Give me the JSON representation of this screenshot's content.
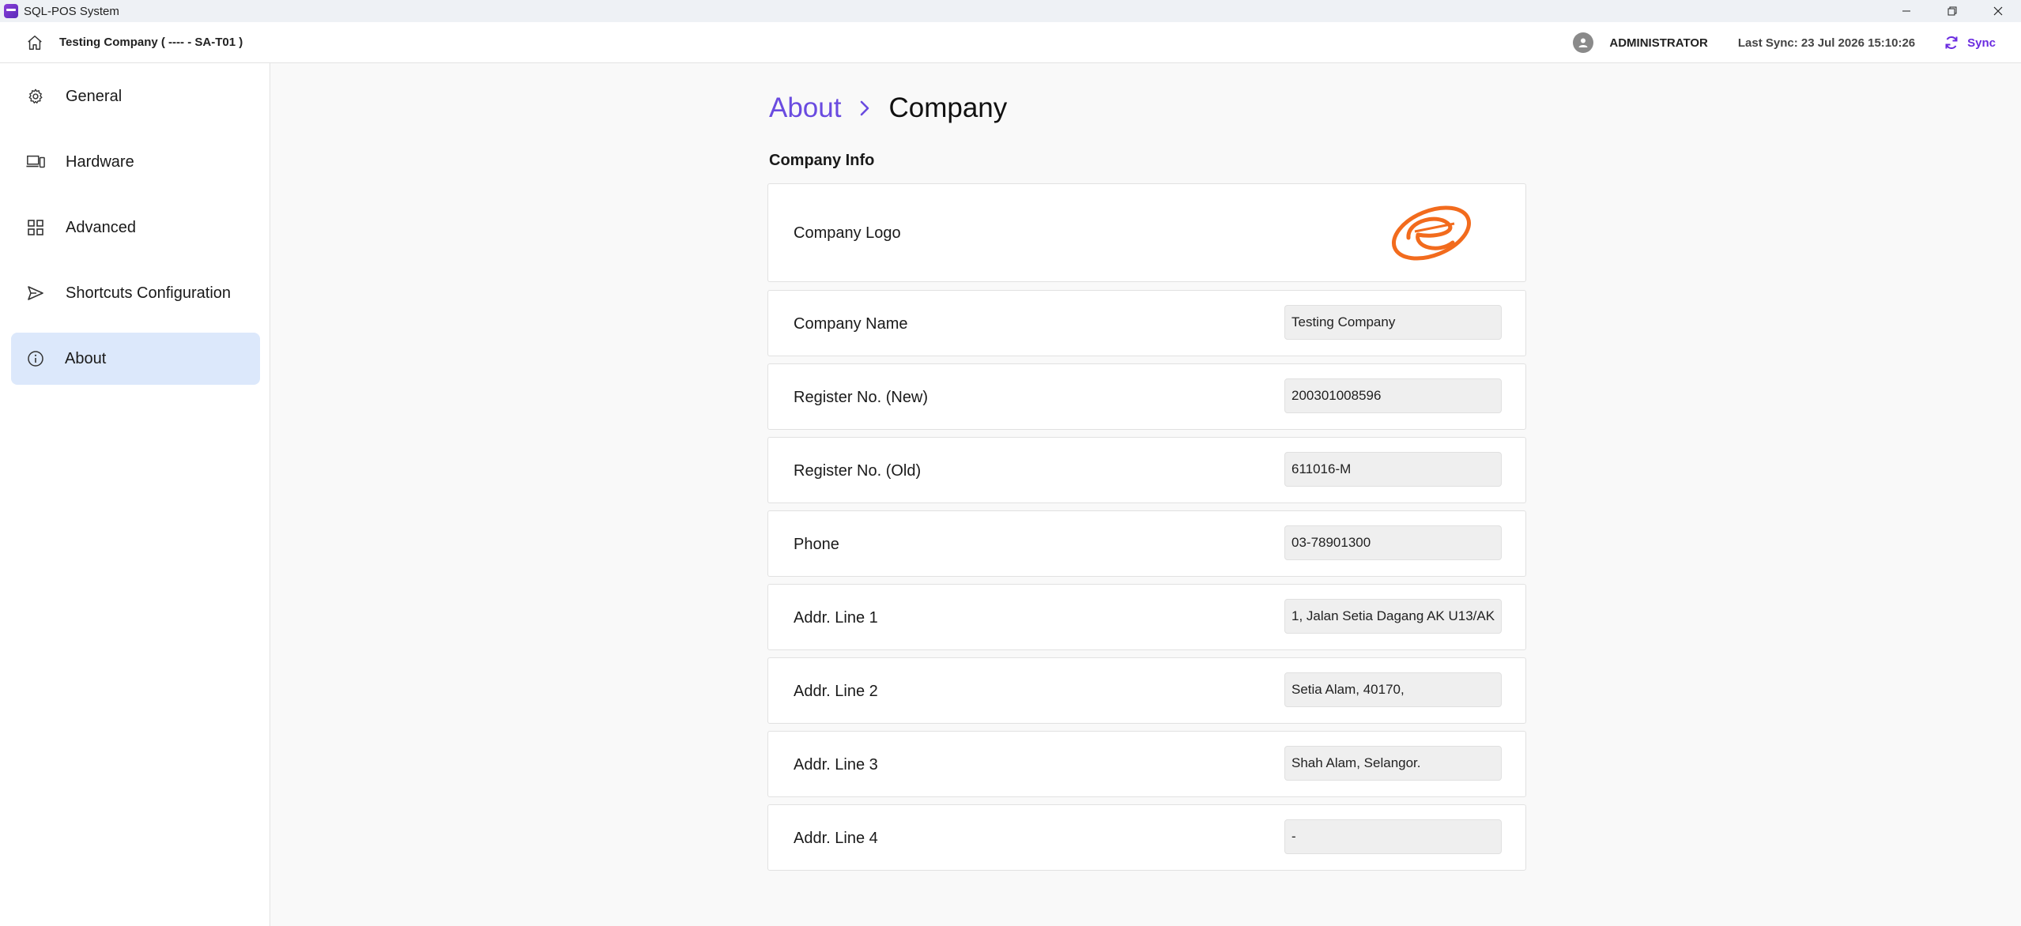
{
  "window": {
    "title": "SQL-POS System",
    "minimize": "—",
    "restore": "⧉",
    "close": "✕"
  },
  "header": {
    "company": "Testing Company ( ---- - SA-T01 )",
    "user": "ADMINISTRATOR",
    "last_sync": "Last Sync: 23 Jul 2026 15:10:26",
    "sync_label": "Sync"
  },
  "sidebar": {
    "items": [
      {
        "label": "General",
        "icon": "gear-icon"
      },
      {
        "label": "Hardware",
        "icon": "devices-icon"
      },
      {
        "label": "Advanced",
        "icon": "grid-icon"
      },
      {
        "label": "Shortcuts Configuration",
        "icon": "send-icon"
      },
      {
        "label": "About",
        "icon": "info-icon",
        "active": true
      }
    ]
  },
  "breadcrumb": {
    "parent": "About",
    "current": "Company"
  },
  "company_info": {
    "title": "Company Info",
    "logo_label": "Company Logo",
    "fields": [
      {
        "label": "Company Name",
        "value": "Testing Company"
      },
      {
        "label": "Register No. (New)",
        "value": "200301008596"
      },
      {
        "label": "Register No. (Old)",
        "value": "611016-M"
      },
      {
        "label": "Phone",
        "value": "03-78901300"
      },
      {
        "label": "Addr. Line 1",
        "value": "1, Jalan Setia Dagang AK U13/AK"
      },
      {
        "label": "Addr. Line 2",
        "value": "Setia Alam, 40170,"
      },
      {
        "label": "Addr. Line 3",
        "value": "Shah Alam, Selangor."
      },
      {
        "label": "Addr. Line 4",
        "value": "-"
      }
    ]
  },
  "colors": {
    "accent": "#6a4be0",
    "active_nav": "#dce8fb",
    "logo": "#f26b1d"
  }
}
